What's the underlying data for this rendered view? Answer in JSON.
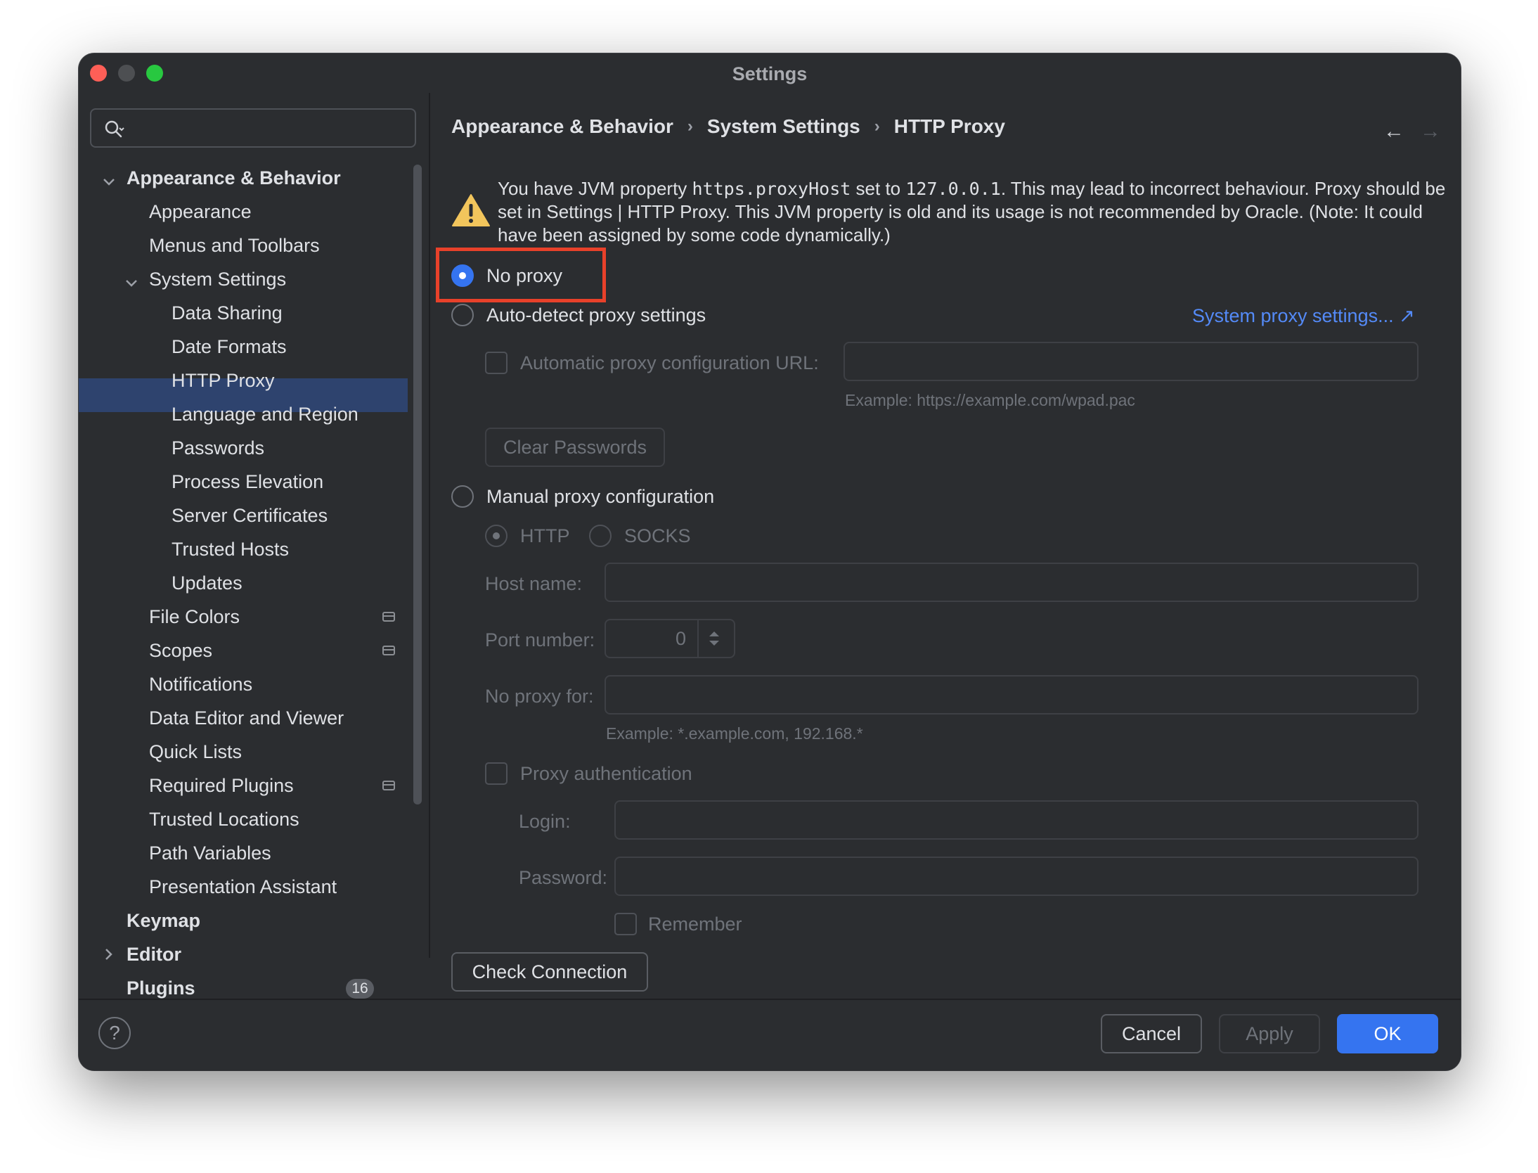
{
  "window": {
    "title": "Settings"
  },
  "sidebar": {
    "search_placeholder": "",
    "items": [
      {
        "label": "Appearance & Behavior"
      },
      {
        "label": "Appearance"
      },
      {
        "label": "Menus and Toolbars"
      },
      {
        "label": "System Settings"
      },
      {
        "label": "Data Sharing"
      },
      {
        "label": "Date Formats"
      },
      {
        "label": "HTTP Proxy"
      },
      {
        "label": "Language and Region"
      },
      {
        "label": "Passwords"
      },
      {
        "label": "Process Elevation"
      },
      {
        "label": "Server Certificates"
      },
      {
        "label": "Trusted Hosts"
      },
      {
        "label": "Updates"
      },
      {
        "label": "File Colors"
      },
      {
        "label": "Scopes"
      },
      {
        "label": "Notifications"
      },
      {
        "label": "Data Editor and Viewer"
      },
      {
        "label": "Quick Lists"
      },
      {
        "label": "Required Plugins"
      },
      {
        "label": "Trusted Locations"
      },
      {
        "label": "Path Variables"
      },
      {
        "label": "Presentation Assistant"
      },
      {
        "label": "Keymap"
      },
      {
        "label": "Editor"
      },
      {
        "label": "Plugins"
      }
    ],
    "plugins_badge": "16",
    "selected": "HTTP Proxy"
  },
  "breadcrumb": {
    "level1": "Appearance & Behavior",
    "level2": "System Settings",
    "level3": "HTTP Proxy"
  },
  "warning": {
    "prefix": "You have JVM property ",
    "property": "https.proxyHost",
    "middle": " set to ",
    "value": "127.0.0.1",
    "suffix": ". This may lead to incorrect behaviour. Proxy should be set in Settings | HTTP Proxy. This JVM property is old and its usage is not recommended by Oracle. (Note: It could have been assigned by some code dynamically.)"
  },
  "proxy": {
    "no_proxy_label": "No proxy",
    "auto_detect_label": "Auto-detect proxy settings",
    "system_proxy_link": "System proxy settings... ↗",
    "auto_config_label": "Automatic proxy configuration URL:",
    "auto_config_value": "",
    "auto_config_hint": "Example: https://example.com/wpad.pac",
    "clear_passwords": "Clear Passwords",
    "manual_label": "Manual proxy configuration",
    "http_label": "HTTP",
    "socks_label": "SOCKS",
    "host_label": "Host name:",
    "host_value": "",
    "port_label": "Port number:",
    "port_value": "0",
    "no_proxy_for_label": "No proxy for:",
    "no_proxy_for_value": "",
    "no_proxy_for_hint": "Example: *.example.com, 192.168.*",
    "auth_label": "Proxy authentication",
    "login_label": "Login:",
    "login_value": "",
    "password_label": "Password:",
    "password_value": "",
    "remember_label": "Remember",
    "check_connection": "Check Connection"
  },
  "footer": {
    "help": "?",
    "cancel": "Cancel",
    "apply": "Apply",
    "ok": "OK"
  },
  "colors": {
    "accent": "#3574f0",
    "highlight": "#e8412a",
    "selection": "#2e436e"
  }
}
